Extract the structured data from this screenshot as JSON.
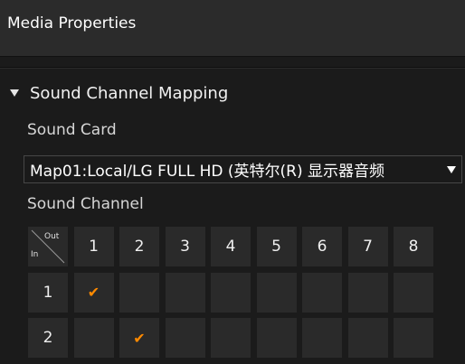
{
  "panel": {
    "title": "Media Properties"
  },
  "section": {
    "title": "Sound Channel Mapping"
  },
  "sound_card": {
    "label": "Sound Card",
    "selected": "Map01:Local/LG FULL HD (英特尔(R) 显示器音频"
  },
  "sound_channel": {
    "label": "Sound Channel",
    "corner": {
      "out": "Out",
      "in": "In"
    },
    "out_headers": [
      "1",
      "2",
      "3",
      "4",
      "5",
      "6",
      "7",
      "8"
    ],
    "rows": [
      {
        "in": "1",
        "checked_out": "1"
      },
      {
        "in": "2",
        "checked_out": "2"
      }
    ],
    "check_mark": "✔"
  },
  "colors": {
    "accent_check": "#ff8a00",
    "cell_bg": "#2a2a2a",
    "panel_bg": "#1b1b1b"
  }
}
